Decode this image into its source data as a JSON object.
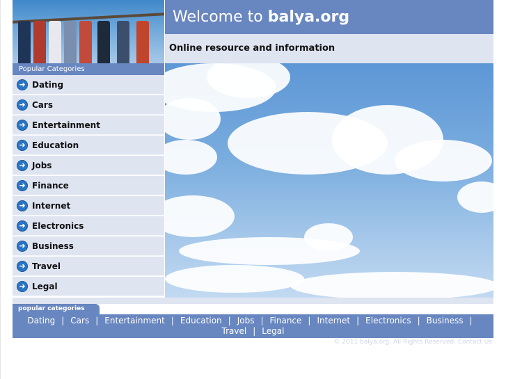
{
  "header": {
    "welcome_prefix": "Welcome to",
    "site_name": "balya.org",
    "tagline": "Online resource and information"
  },
  "sidebar": {
    "title": "Popular Categories",
    "items": [
      {
        "label": "Dating"
      },
      {
        "label": "Cars"
      },
      {
        "label": "Entertainment"
      },
      {
        "label": "Education"
      },
      {
        "label": "Jobs"
      },
      {
        "label": "Finance"
      },
      {
        "label": "Internet"
      },
      {
        "label": "Electronics"
      },
      {
        "label": "Business"
      },
      {
        "label": "Travel"
      },
      {
        "label": "Legal"
      }
    ]
  },
  "footer": {
    "tab_label": "popular categories",
    "links": [
      "Dating",
      "Cars",
      "Entertainment",
      "Education",
      "Jobs",
      "Finance",
      "Internet",
      "Electronics",
      "Business",
      "Travel",
      "Legal"
    ],
    "copyright": "© 2011 balya.org. All Rights Reserved. Contact Us"
  },
  "colors": {
    "accent_blue": "#6886bf",
    "light_panel": "#dfe4f1",
    "arrow_icon": "#2a74c4"
  },
  "icons": {
    "category_bullet": "arrow-right-circle-icon"
  }
}
